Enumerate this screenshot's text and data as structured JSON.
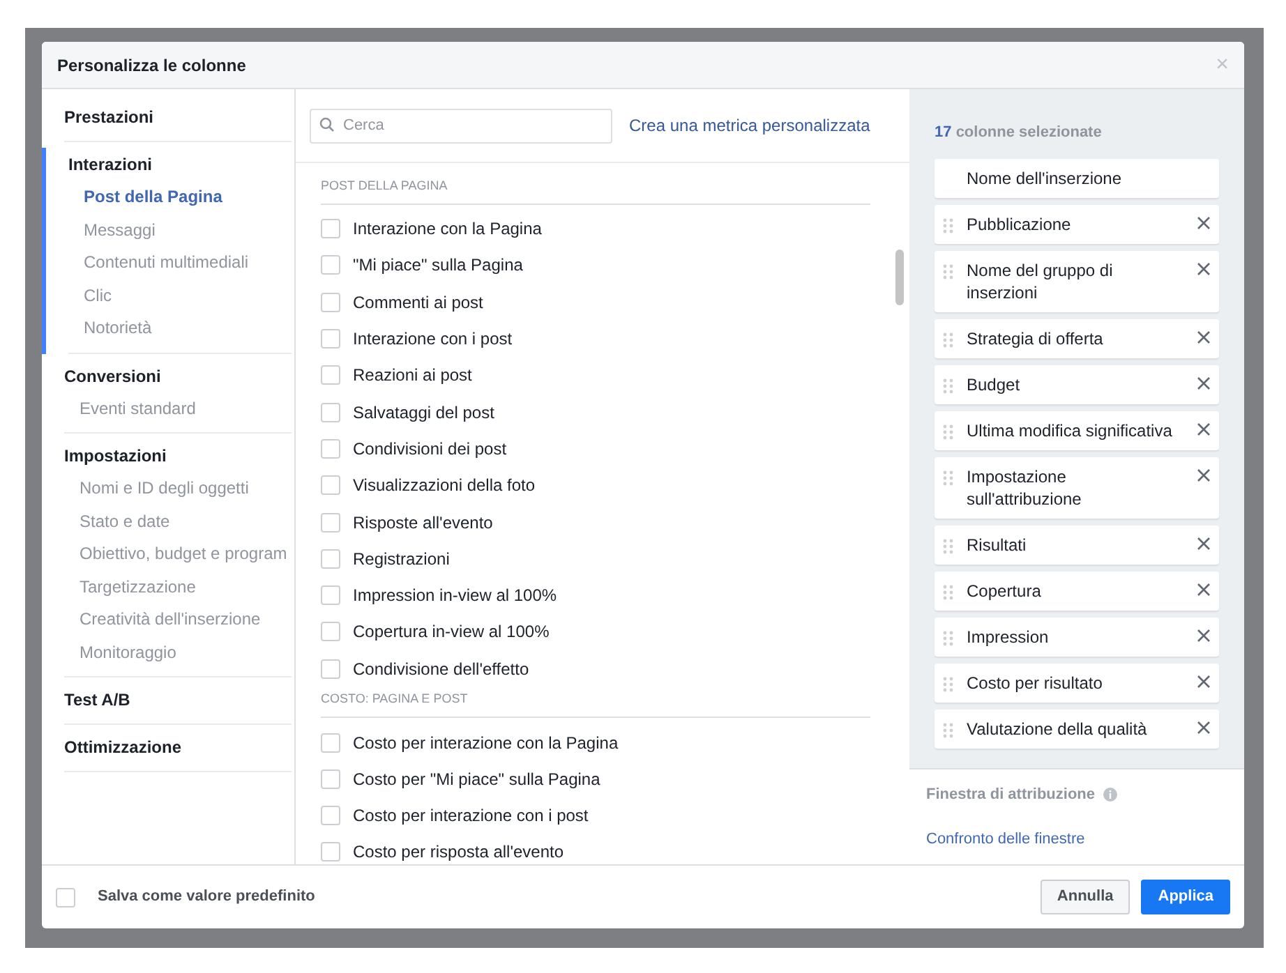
{
  "dialog": {
    "title": "Personalizza le colonne",
    "close_label": "×"
  },
  "sidebar": [
    {
      "label": "Prestazioni",
      "selected": false
    },
    {
      "label": "Interazioni",
      "selected": true,
      "items": [
        {
          "label": "Post della Pagina",
          "selected": true
        },
        {
          "label": "Messaggi",
          "selected": false
        },
        {
          "label": "Contenuti multimediali",
          "selected": false
        },
        {
          "label": "Clic",
          "selected": false
        },
        {
          "label": "Notorietà",
          "selected": false
        }
      ]
    },
    {
      "label": "Conversioni",
      "selected": false,
      "items": [
        {
          "label": "Eventi standard",
          "selected": false
        }
      ]
    },
    {
      "label": "Impostazioni",
      "selected": false,
      "items": [
        {
          "label": "Nomi e ID degli oggetti",
          "selected": false
        },
        {
          "label": "Stato e date",
          "selected": false
        },
        {
          "label": "Obiettivo, budget e program",
          "selected": false
        },
        {
          "label": "Targetizzazione",
          "selected": false
        },
        {
          "label": "Creatività dell'inserzione",
          "selected": false
        },
        {
          "label": "Monitoraggio",
          "selected": false
        }
      ]
    },
    {
      "label": "Test A/B",
      "selected": false
    },
    {
      "label": "Ottimizzazione",
      "selected": false
    }
  ],
  "search": {
    "placeholder": "Cerca"
  },
  "create_metric_link": "Crea una metrica personalizzata",
  "metric_groups": [
    {
      "heading": "POST DELLA PAGINA",
      "items": [
        {
          "label": "Interazione con la Pagina",
          "checked": false
        },
        {
          "label": "\"Mi piace\" sulla Pagina",
          "checked": false
        },
        {
          "label": "Commenti ai post",
          "checked": false
        },
        {
          "label": "Interazione con i post",
          "checked": false
        },
        {
          "label": "Reazioni ai post",
          "checked": false
        },
        {
          "label": "Salvataggi del post",
          "checked": false
        },
        {
          "label": "Condivisioni dei post",
          "checked": false
        },
        {
          "label": "Visualizzazioni della foto",
          "checked": false
        },
        {
          "label": "Risposte all'evento",
          "checked": false
        },
        {
          "label": "Registrazioni",
          "checked": false
        },
        {
          "label": "Impression in-view al 100%",
          "checked": false
        },
        {
          "label": "Copertura in-view al 100%",
          "checked": false
        },
        {
          "label": "Condivisione dell'effetto",
          "checked": false
        }
      ]
    },
    {
      "heading": "COSTO: PAGINA E POST",
      "items": [
        {
          "label": "Costo per interazione con la Pagina",
          "checked": false
        },
        {
          "label": "Costo per \"Mi piace\" sulla Pagina",
          "checked": false
        },
        {
          "label": "Costo per interazione con i post",
          "checked": false
        },
        {
          "label": "Costo per risposta all'evento",
          "checked": false
        }
      ]
    }
  ],
  "selected_columns": {
    "count": "17",
    "label": "colonne selezionate",
    "columns": [
      {
        "label": "Nome dell'inserzione",
        "removable": false
      },
      {
        "label": "Pubblicazione",
        "removable": true
      },
      {
        "label": "Nome del gruppo di inserzioni",
        "removable": true
      },
      {
        "label": "Strategia di offerta",
        "removable": true
      },
      {
        "label": "Budget",
        "removable": true
      },
      {
        "label": "Ultima modifica significativa",
        "removable": true
      },
      {
        "label": "Impostazione sull'attribuzione",
        "removable": true
      },
      {
        "label": "Risultati",
        "removable": true
      },
      {
        "label": "Copertura",
        "removable": true
      },
      {
        "label": "Impression",
        "removable": true
      },
      {
        "label": "Costo per risultato",
        "removable": true
      },
      {
        "label": "Valutazione della qualità",
        "removable": true
      }
    ]
  },
  "attribution": {
    "label": "Finestra di attribuzione",
    "link": "Confronto delle finestre"
  },
  "footer": {
    "save_default": {
      "label": "Salva come valore predefinito",
      "checked": false
    },
    "buttons": [
      {
        "label": "Annulla",
        "kind": "secondary"
      },
      {
        "label": "Applica",
        "kind": "primary"
      }
    ]
  }
}
